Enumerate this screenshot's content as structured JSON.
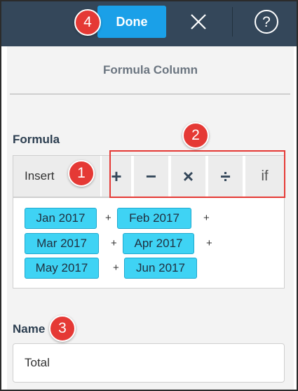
{
  "header": {
    "done_label": "Done",
    "close_icon": "close-icon",
    "help_icon": "help-icon"
  },
  "panel": {
    "title": "Formula Column",
    "formula_label": "Formula",
    "name_label": "Name"
  },
  "toolbar": {
    "insert_label": "Insert",
    "operators": [
      "+",
      "−",
      "×",
      "÷",
      "if"
    ]
  },
  "formula": {
    "rows": [
      {
        "tokens": [
          "Jan 2017",
          "Feb 2017"
        ]
      },
      {
        "tokens": [
          "Mar 2017",
          "Apr 2017"
        ]
      },
      {
        "tokens": [
          "May 2017",
          "Jun 2017"
        ]
      }
    ],
    "operator": "+"
  },
  "name_field": {
    "value": "Total"
  },
  "callouts": [
    "1",
    "2",
    "3",
    "4"
  ],
  "colors": {
    "topbar": "#34475a",
    "done_button": "#1aa0e8",
    "token": "#3fd3f4",
    "callout": "#e53935"
  }
}
